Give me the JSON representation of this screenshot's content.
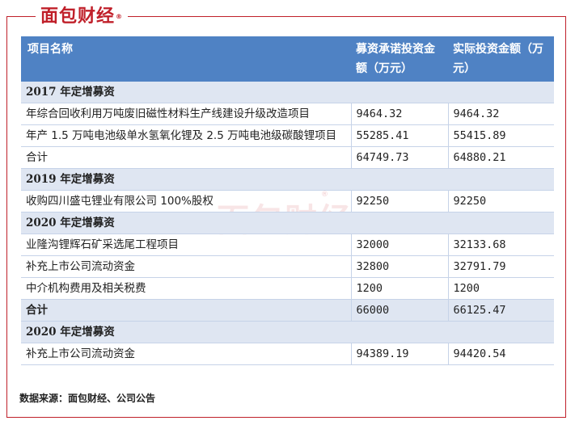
{
  "logo": {
    "text": "面包财经",
    "mark": "®"
  },
  "watermark": {
    "text": "面包财经",
    "mark": "®"
  },
  "headers": [
    "项目名称",
    "募资承诺投资金额（万元）",
    "实际投资金额（万元）"
  ],
  "rows": [
    {
      "kind": "section",
      "name": "2017 年定增募资"
    },
    {
      "kind": "item",
      "name": "年综合回收利用万吨废旧磁性材料生产线建设升级改造项目",
      "promised": "9464.32",
      "actual": "9464.32"
    },
    {
      "kind": "item",
      "name": "年产 1.5 万吨电池级单水氢氧化锂及 2.5 万吨电池级碳酸锂项目",
      "promised": "55285.41",
      "actual": "55415.89"
    },
    {
      "kind": "item",
      "name": "合计",
      "promised": "64749.73",
      "actual": "64880.21"
    },
    {
      "kind": "section",
      "name": "2019 年定增募资"
    },
    {
      "kind": "item",
      "name": "收购四川盛屯锂业有限公司 100%股权",
      "promised": "92250",
      "actual": "92250"
    },
    {
      "kind": "section",
      "name": "2020 年定增募资"
    },
    {
      "kind": "item",
      "name": "业隆沟锂辉石矿采选尾工程项目",
      "promised": "32000",
      "actual": "32133.68"
    },
    {
      "kind": "item",
      "name": "补充上市公司流动资金",
      "promised": "32800",
      "actual": "32791.79"
    },
    {
      "kind": "item",
      "name": "中介机构费用及相关税费",
      "promised": "1200",
      "actual": "1200"
    },
    {
      "kind": "total",
      "name": "合计",
      "promised": "66000",
      "actual": "66125.47"
    },
    {
      "kind": "section",
      "name": "2020 年定增募资"
    },
    {
      "kind": "item",
      "name": "补充上市公司流动资金",
      "promised": "94389.19",
      "actual": "94420.54"
    }
  ],
  "source": "数据来源：面包财经、公司公告",
  "colors": {
    "brand": "#c0202a",
    "header_bg": "#4f82c4",
    "section_bg": "#dfe6f2"
  }
}
